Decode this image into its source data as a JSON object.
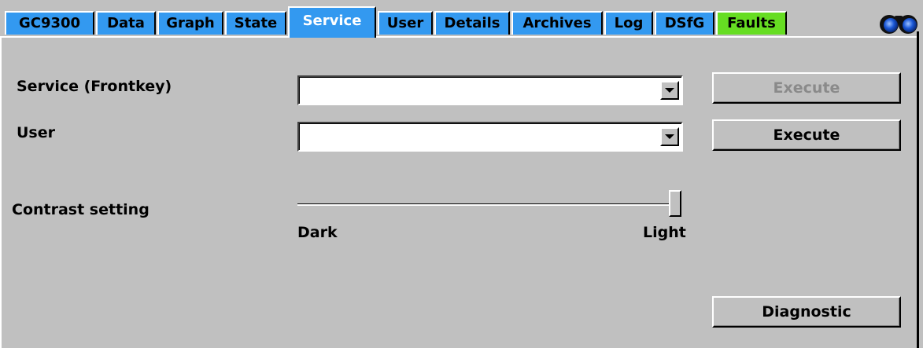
{
  "tabs": [
    {
      "label": "GC9300",
      "active": false
    },
    {
      "label": "Data",
      "active": false
    },
    {
      "label": "Graph",
      "active": false
    },
    {
      "label": "State",
      "active": false
    },
    {
      "label": "Service",
      "active": true
    },
    {
      "label": "User",
      "active": false
    },
    {
      "label": "Details",
      "active": false
    },
    {
      "label": "Archives",
      "active": false
    },
    {
      "label": "Log",
      "active": false
    },
    {
      "label": "DSfG",
      "active": false
    },
    {
      "label": "Faults",
      "active": false
    }
  ],
  "colors": {
    "background": "#c0c0c0",
    "tab_blue": "#3399f0",
    "tab_faults_green": "#66dd22",
    "active_tab_text": "#ffffff",
    "disabled_text": "#8a8a8a"
  },
  "toolbar": {
    "binoculars_icon": "binoculars-icon"
  },
  "form": {
    "service_label": "Service (Frontkey)",
    "service_value": "",
    "service_execute_label": "Execute",
    "service_execute_enabled": false,
    "user_label": "User",
    "user_value": "",
    "user_execute_label": "Execute",
    "user_execute_enabled": true
  },
  "contrast": {
    "label": "Contrast setting",
    "min_label": "Dark",
    "max_label": "Light",
    "value_fraction": 1.0
  },
  "diagnostic": {
    "label": "Diagnostic"
  }
}
